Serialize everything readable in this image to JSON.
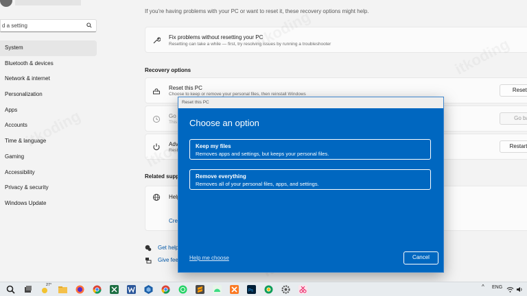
{
  "search": {
    "value": "d a setting"
  },
  "sidebar": {
    "items": [
      {
        "label": "System",
        "active": true
      },
      {
        "label": "Bluetooth & devices"
      },
      {
        "label": "Network & internet"
      },
      {
        "label": "Personalization"
      },
      {
        "label": "Apps"
      },
      {
        "label": "Accounts"
      },
      {
        "label": "Time & language"
      },
      {
        "label": "Gaming"
      },
      {
        "label": "Accessibility"
      },
      {
        "label": "Privacy & security"
      },
      {
        "label": "Windows Update"
      }
    ]
  },
  "main": {
    "intro": "If you're having problems with your PC or want to reset it, these recovery options might help.",
    "fix": {
      "title": "Fix problems without resetting your PC",
      "subtitle": "Resetting can take a while — first, try resolving issues by running a troubleshooter"
    },
    "recovery_heading": "Recovery options",
    "reset": {
      "title": "Reset this PC",
      "subtitle": "Choose to keep or remove your personal files, then reinstall Windows",
      "button": "Reset PC"
    },
    "goback": {
      "title": "Go b",
      "subtitle": "This",
      "button": "Go back"
    },
    "advanced": {
      "title": "Adva",
      "subtitle": "Rest",
      "button": "Restart now"
    },
    "related_heading": "Related suppo",
    "help": {
      "title": "Help",
      "link": "Crea"
    },
    "get_help": "Get help",
    "give_feedback": "Give feed"
  },
  "dialog": {
    "titlebar": "Reset this PC",
    "heading": "Choose an option",
    "options": [
      {
        "title": "Keep my files",
        "desc": "Removes apps and settings, but keeps your personal files."
      },
      {
        "title": "Remove everything",
        "desc": "Removes all of your personal files, apps, and settings."
      }
    ],
    "help_link": "Help me choose",
    "cancel": "Cancel"
  },
  "taskbar": {
    "weather": "27°",
    "language": "ENG",
    "icons": [
      "search-icon",
      "task-view-icon",
      "weather-icon",
      "file-explorer-icon",
      "firefox-icon",
      "chrome-icon",
      "excel-icon",
      "word-icon",
      "virtualbox-icon",
      "chrome-alt-icon",
      "whatsapp-icon",
      "sublime-icon",
      "android-icon",
      "xampp-icon",
      "photoshop-icon",
      "chrome-dev-icon",
      "settings-icon",
      "snipping-icon"
    ]
  },
  "watermark": "itkoding",
  "colors": {
    "accent": "#0067c0",
    "link": "#0057a8"
  }
}
